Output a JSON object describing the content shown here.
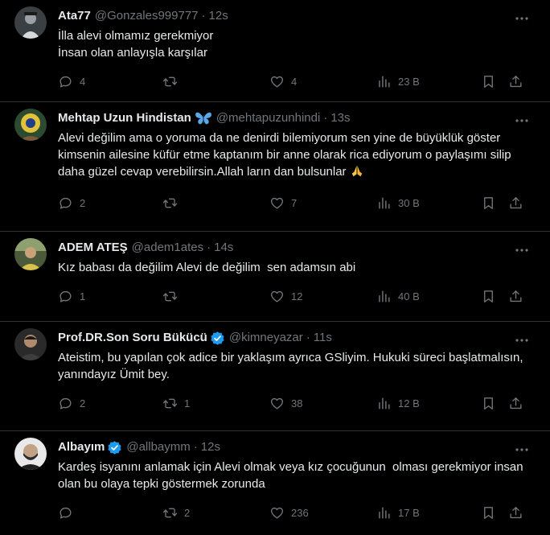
{
  "tweets": [
    {
      "name": "Ata77",
      "handle": "@Gonzales999777",
      "time": "12s",
      "text": "İlla alevi olmamız gerekmiyor\nİnsan olan anlayışla karşılar",
      "replies": "4",
      "retweets": "",
      "likes": "4",
      "views": "23 B"
    },
    {
      "name": "Mehtap Uzun Hindistan",
      "name_emoji": "butterfly-icon",
      "handle": "@mehtapuzunhindi",
      "time": "13s",
      "text": "Alevi değilim ama o yoruma da ne denirdi bilemiyorum sen yine de büyüklük göster kimsenin ailesine küfür etme kaptanım bir anne olarak rica ediyorum o paylaşımı silip daha güzel cevap verebilirsin.Allah ların dan bulsunlar",
      "text_emoji": "folded-hands-icon",
      "replies": "2",
      "retweets": "",
      "likes": "7",
      "views": "30 B"
    },
    {
      "name": "ADEM ATEŞ",
      "handle": "@adem1ates",
      "time": "14s",
      "text": "Kız babası da değilim Alevi de değilim  sen adamsın abi",
      "replies": "1",
      "retweets": "",
      "likes": "12",
      "views": "40 B"
    },
    {
      "name": "Prof.DR.Son Soru Bükücü",
      "verified": true,
      "handle": "@kimneyazar",
      "time": "11s",
      "text": "Ateistim, bu yapılan çok adice bir yaklaşım ayrıca GSliyim. Hukuki süreci başlatmalısın, yanındayız Ümit bey.",
      "replies": "2",
      "retweets": "1",
      "likes": "38",
      "views": "12 B"
    },
    {
      "name": "Albayım",
      "verified": true,
      "handle": "@allbaymm",
      "time": "12s",
      "text": "Kardeş isyanını anlamak için Alevi olmak veya kız çocuğunun  olması gerekmiyor insan olan bu olaya tepki göstermek zorunda",
      "replies": "",
      "retweets": "2",
      "likes": "236",
      "views": "17 B"
    }
  ],
  "separator": "·",
  "colors": {
    "background": "#000000",
    "text": "#e7e9ea",
    "muted": "#71767b",
    "border": "#2f3336",
    "verified": "#1d9bf0"
  }
}
